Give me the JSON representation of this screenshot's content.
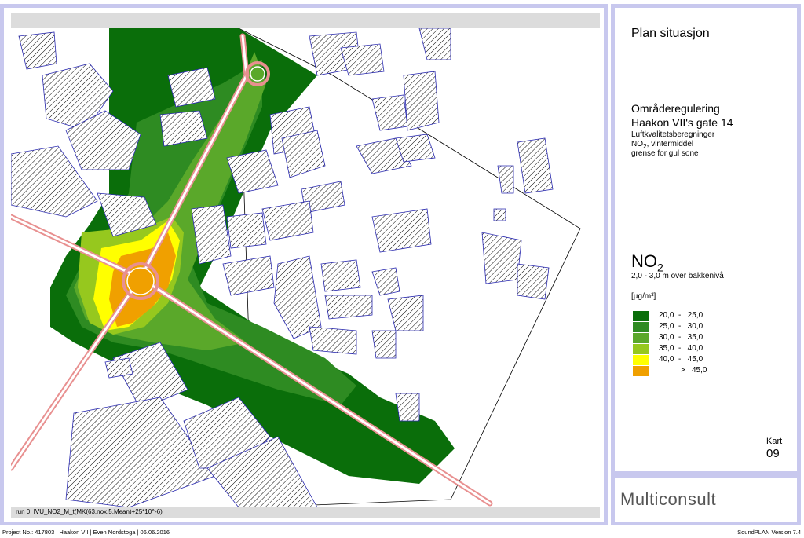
{
  "map_panel": {
    "run_label": "run 0: IVU_NO2_M_t(MK(63,nox,5,Mean)+25*10^-6)"
  },
  "info_panel": {
    "plan_title": "Plan situasjon",
    "project_title_line1": "Områderegulering",
    "project_title_line2": "Haakon VII's gate 14",
    "subtitle_line1": "Luftkvalitetsberegninger",
    "subtitle_line2_prefix": "NO",
    "subtitle_line2_sub": "2",
    "subtitle_line2_suffix": ", vintermiddel",
    "subtitle_line3": "grense for gul sone",
    "pollutant_prefix": "NO",
    "pollutant_sub": "2",
    "height_text": "2,0 - 3,0 m over bakkenivå",
    "unit_text": "[µg/m³]",
    "legend": [
      {
        "label": "20,0  -   25,0",
        "color": "#0a6e0a"
      },
      {
        "label": "25,0  -   30,0",
        "color": "#2e8b22"
      },
      {
        "label": "30,0  -   35,0",
        "color": "#5aa82a"
      },
      {
        "label": "35,0  -   40,0",
        "color": "#96c81e"
      },
      {
        "label": "40,0  -   45,0",
        "color": "#ffff00"
      },
      {
        "label": "          >   45,0",
        "color": "#f0a000"
      }
    ],
    "kart_label": "Kart",
    "kart_number": "09"
  },
  "logo": {
    "text": "Multiconsult"
  },
  "footer": {
    "left": "Project No.: 417803 | Haakon VII | Even Nordstoga | 06.06.2016",
    "right": "SoundPLAN Version 7.4"
  },
  "colors": {
    "frame": "#c8c8ee",
    "road": "#e89090",
    "building_outline": "#2a2ab0",
    "hatch": "#000000"
  }
}
